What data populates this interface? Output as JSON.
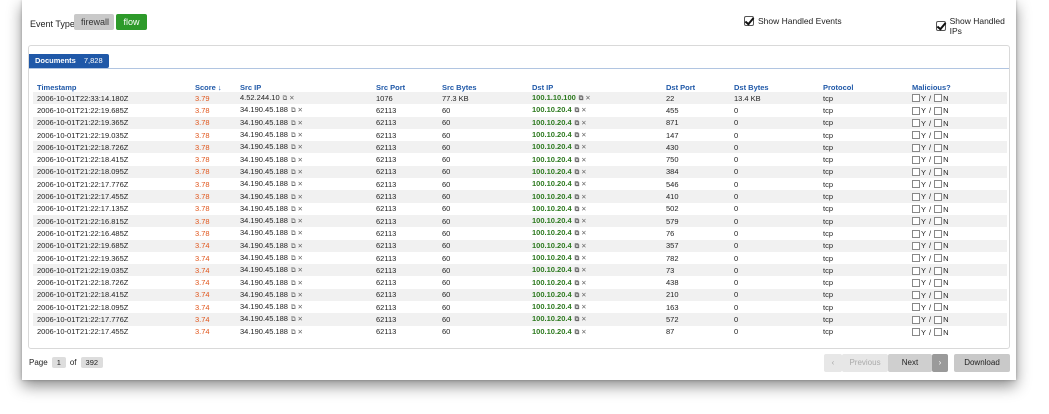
{
  "toolbar": {
    "event_types_label": "Event Types:",
    "firewall_label": "firewall",
    "flow_label": "flow",
    "show_handled_events": "Show Handled Events",
    "show_handled_ips": "Show Handled IPs",
    "show_handled_events_checked": true,
    "show_handled_ips_checked": true
  },
  "documents": {
    "label": "Documents",
    "count": "7,828"
  },
  "table": {
    "columns": [
      "Timestamp",
      "Score ↓",
      "Src IP",
      "Src Port",
      "Src Bytes",
      "Dst IP",
      "Dst Port",
      "Dst Bytes",
      "Protocol",
      "Malicious?"
    ],
    "rows": [
      {
        "ts": "2006-10-01T22:33:14.180Z",
        "score": "3.79",
        "src_ip": "4.52.244.10",
        "src_port": "1076",
        "src_bytes": "77.3 KB",
        "dst_ip": "100.1.10.100",
        "dst_port": "22",
        "dst_bytes": "13.4 KB",
        "proto": "tcp"
      },
      {
        "ts": "2006-10-01T21:22:19.685Z",
        "score": "3.78",
        "src_ip": "34.190.45.188",
        "src_port": "62113",
        "src_bytes": "60",
        "dst_ip": "100.10.20.4",
        "dst_port": "455",
        "dst_bytes": "0",
        "proto": "tcp"
      },
      {
        "ts": "2006-10-01T21:22:19.365Z",
        "score": "3.78",
        "src_ip": "34.190.45.188",
        "src_port": "62113",
        "src_bytes": "60",
        "dst_ip": "100.10.20.4",
        "dst_port": "871",
        "dst_bytes": "0",
        "proto": "tcp"
      },
      {
        "ts": "2006-10-01T21:22:19.035Z",
        "score": "3.78",
        "src_ip": "34.190.45.188",
        "src_port": "62113",
        "src_bytes": "60",
        "dst_ip": "100.10.20.4",
        "dst_port": "147",
        "dst_bytes": "0",
        "proto": "tcp"
      },
      {
        "ts": "2006-10-01T21:22:18.726Z",
        "score": "3.78",
        "src_ip": "34.190.45.188",
        "src_port": "62113",
        "src_bytes": "60",
        "dst_ip": "100.10.20.4",
        "dst_port": "430",
        "dst_bytes": "0",
        "proto": "tcp"
      },
      {
        "ts": "2006-10-01T21:22:18.415Z",
        "score": "3.78",
        "src_ip": "34.190.45.188",
        "src_port": "62113",
        "src_bytes": "60",
        "dst_ip": "100.10.20.4",
        "dst_port": "750",
        "dst_bytes": "0",
        "proto": "tcp"
      },
      {
        "ts": "2006-10-01T21:22:18.095Z",
        "score": "3.78",
        "src_ip": "34.190.45.188",
        "src_port": "62113",
        "src_bytes": "60",
        "dst_ip": "100.10.20.4",
        "dst_port": "384",
        "dst_bytes": "0",
        "proto": "tcp"
      },
      {
        "ts": "2006-10-01T21:22:17.776Z",
        "score": "3.78",
        "src_ip": "34.190.45.188",
        "src_port": "62113",
        "src_bytes": "60",
        "dst_ip": "100.10.20.4",
        "dst_port": "546",
        "dst_bytes": "0",
        "proto": "tcp"
      },
      {
        "ts": "2006-10-01T21:22:17.455Z",
        "score": "3.78",
        "src_ip": "34.190.45.188",
        "src_port": "62113",
        "src_bytes": "60",
        "dst_ip": "100.10.20.4",
        "dst_port": "410",
        "dst_bytes": "0",
        "proto": "tcp"
      },
      {
        "ts": "2006-10-01T21:22:17.135Z",
        "score": "3.78",
        "src_ip": "34.190.45.188",
        "src_port": "62113",
        "src_bytes": "60",
        "dst_ip": "100.10.20.4",
        "dst_port": "502",
        "dst_bytes": "0",
        "proto": "tcp"
      },
      {
        "ts": "2006-10-01T21:22:16.815Z",
        "score": "3.78",
        "src_ip": "34.190.45.188",
        "src_port": "62113",
        "src_bytes": "60",
        "dst_ip": "100.10.20.4",
        "dst_port": "579",
        "dst_bytes": "0",
        "proto": "tcp"
      },
      {
        "ts": "2006-10-01T21:22:16.485Z",
        "score": "3.78",
        "src_ip": "34.190.45.188",
        "src_port": "62113",
        "src_bytes": "60",
        "dst_ip": "100.10.20.4",
        "dst_port": "76",
        "dst_bytes": "0",
        "proto": "tcp"
      },
      {
        "ts": "2006-10-01T21:22:19.685Z",
        "score": "3.74",
        "src_ip": "34.190.45.188",
        "src_port": "62113",
        "src_bytes": "60",
        "dst_ip": "100.10.20.4",
        "dst_port": "357",
        "dst_bytes": "0",
        "proto": "tcp"
      },
      {
        "ts": "2006-10-01T21:22:19.365Z",
        "score": "3.74",
        "src_ip": "34.190.45.188",
        "src_port": "62113",
        "src_bytes": "60",
        "dst_ip": "100.10.20.4",
        "dst_port": "782",
        "dst_bytes": "0",
        "proto": "tcp"
      },
      {
        "ts": "2006-10-01T21:22:19.035Z",
        "score": "3.74",
        "src_ip": "34.190.45.188",
        "src_port": "62113",
        "src_bytes": "60",
        "dst_ip": "100.10.20.4",
        "dst_port": "73",
        "dst_bytes": "0",
        "proto": "tcp"
      },
      {
        "ts": "2006-10-01T21:22:18.726Z",
        "score": "3.74",
        "src_ip": "34.190.45.188",
        "src_port": "62113",
        "src_bytes": "60",
        "dst_ip": "100.10.20.4",
        "dst_port": "438",
        "dst_bytes": "0",
        "proto": "tcp"
      },
      {
        "ts": "2006-10-01T21:22:18.415Z",
        "score": "3.74",
        "src_ip": "34.190.45.188",
        "src_port": "62113",
        "src_bytes": "60",
        "dst_ip": "100.10.20.4",
        "dst_port": "210",
        "dst_bytes": "0",
        "proto": "tcp"
      },
      {
        "ts": "2006-10-01T21:22:18.095Z",
        "score": "3.74",
        "src_ip": "34.190.45.188",
        "src_port": "62113",
        "src_bytes": "60",
        "dst_ip": "100.10.20.4",
        "dst_port": "163",
        "dst_bytes": "0",
        "proto": "tcp"
      },
      {
        "ts": "2006-10-01T21:22:17.776Z",
        "score": "3.74",
        "src_ip": "34.190.45.188",
        "src_port": "62113",
        "src_bytes": "60",
        "dst_ip": "100.10.20.4",
        "dst_port": "572",
        "dst_bytes": "0",
        "proto": "tcp"
      },
      {
        "ts": "2006-10-01T21:22:17.455Z",
        "score": "3.74",
        "src_ip": "34.190.45.188",
        "src_port": "62113",
        "src_bytes": "60",
        "dst_ip": "100.10.20.4",
        "dst_port": "87",
        "dst_bytes": "0",
        "proto": "tcp"
      }
    ],
    "malicious_yes": "Y",
    "malicious_sep": "/",
    "malicious_no": "N",
    "icons": [
      "copy-icon",
      "close-icon"
    ]
  },
  "pagination": {
    "page_label": "Page",
    "current_page": "1",
    "of_label": "of",
    "total_pages": "392",
    "previous_label": "Previous",
    "next_label": "Next",
    "download_label": "Download",
    "prev_arrow": "‹",
    "next_arrow": "›"
  },
  "colors": {
    "flow_active": "#2d9a2a",
    "documents_tab": "#1f58a8",
    "score": "#e0561c",
    "dst_ip": "#2d7a1f",
    "header_text": "#1f58a8"
  }
}
